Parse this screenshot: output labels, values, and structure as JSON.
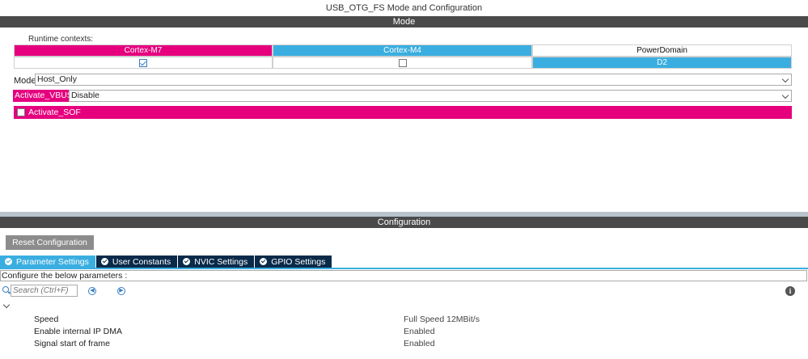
{
  "window": {
    "title": "USB_OTG_FS Mode and Configuration"
  },
  "mode_section": {
    "header": "Mode",
    "runtime_contexts_label": "Runtime contexts:",
    "contexts": [
      {
        "label": "Cortex-M7",
        "checked": true,
        "color": "#e6007e"
      },
      {
        "label": "Cortex-M4",
        "checked": false,
        "color": "#3aaee0"
      }
    ],
    "power_domain": {
      "label": "PowerDomain",
      "value": "D2",
      "color": "#3aaee0"
    },
    "mode": {
      "label": "Mode",
      "value": "Host_Only"
    },
    "activate_vbus": {
      "label": "Activate_VBUS",
      "value": "Disable"
    },
    "activate_sof": {
      "label": "Activate_SOF",
      "checked": false
    }
  },
  "config_section": {
    "header": "Configuration",
    "reset_button": "Reset Configuration",
    "tabs": [
      {
        "label": "Parameter Settings",
        "active": true
      },
      {
        "label": "User Constants",
        "active": false
      },
      {
        "label": "NVIC Settings",
        "active": false
      },
      {
        "label": "GPIO Settings",
        "active": false
      }
    ],
    "configure_text": "Configure the below parameters :",
    "search": {
      "placeholder": "Search (Ctrl+F)"
    },
    "parameters": [
      {
        "name": "Speed",
        "value": "Full Speed 12MBit/s"
      },
      {
        "name": "Enable internal IP DMA",
        "value": "Enabled"
      },
      {
        "name": "Signal start of frame",
        "value": "Enabled"
      }
    ]
  },
  "colors": {
    "accent_pink": "#e6007e",
    "accent_blue": "#3aaee0",
    "tab_dark": "#0a2a4a",
    "section_bar": "#4a4a4a"
  }
}
